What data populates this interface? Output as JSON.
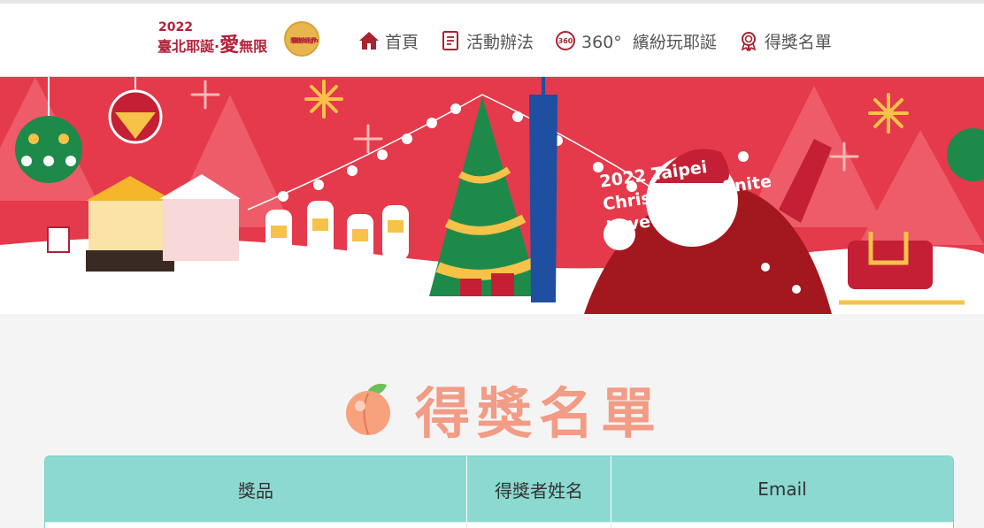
{
  "header": {
    "logo": {
      "year": "2022",
      "title_part1": "臺北耶誕",
      "title_dot": "·",
      "title_big": "愛",
      "title_part2": "無限",
      "badge_line1": "繽紛經界",
      "badge_line2": "陪你high"
    },
    "nav": [
      {
        "label": "首頁",
        "icon": "home-icon"
      },
      {
        "label": "活動辦法",
        "icon": "document-icon"
      },
      {
        "label": "360°  繽紛玩耶誕",
        "icon": "360-view-icon"
      },
      {
        "label": "得獎名單",
        "icon": "award-ribbon-icon"
      }
    ]
  },
  "banner": {
    "headline": "2022 Taipei\nChristmas-Infinite\nLove"
  },
  "winners": {
    "title": "得獎名單",
    "title_icon": "peach-icon",
    "columns": [
      "獎品",
      "得獎者姓名",
      "Email"
    ]
  },
  "colors": {
    "brand_red": "#b2213a",
    "banner_red": "#e43a4c",
    "title_salmon": "#f29b85",
    "table_header_teal": "#8bd9d0",
    "nav_icon_red": "#a8232f"
  }
}
